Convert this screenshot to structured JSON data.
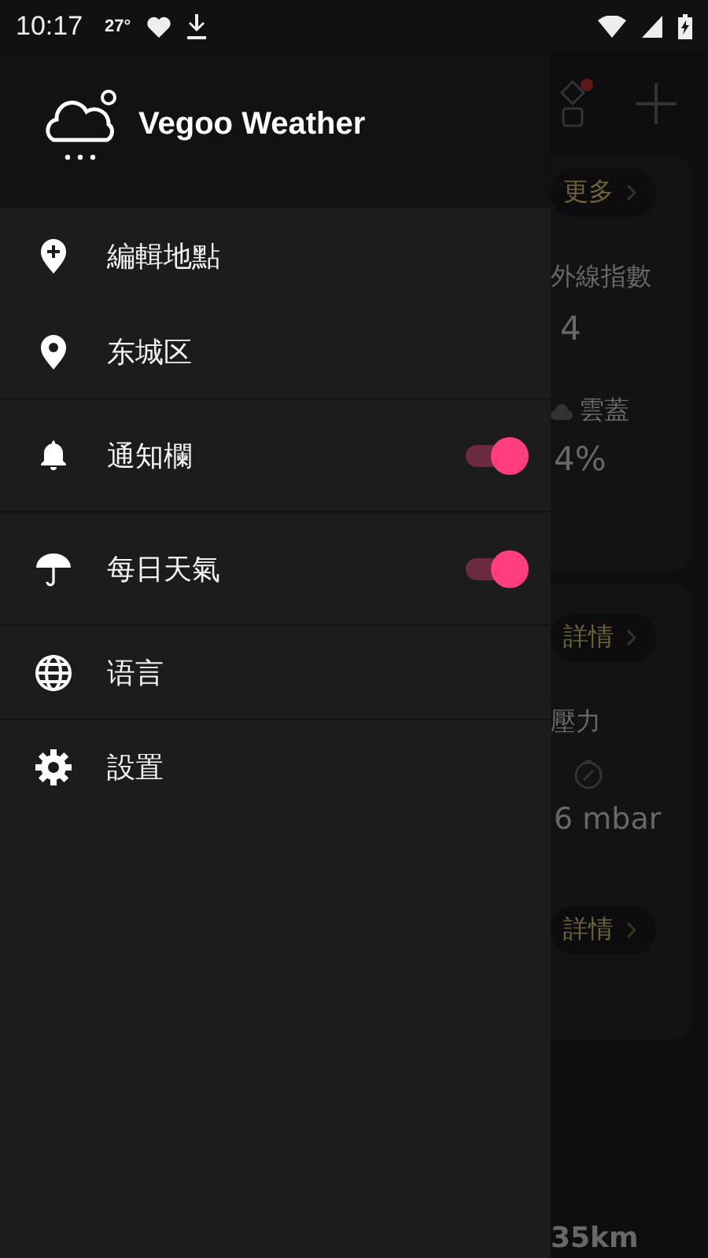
{
  "status_bar": {
    "time": "10:17",
    "temperature": "27°"
  },
  "drawer": {
    "app_name": "Vegoo Weather",
    "menu": [
      {
        "label": "編輯地點",
        "kind": "plain"
      },
      {
        "label": "东城区",
        "kind": "plain"
      },
      {
        "label": "通知欄",
        "kind": "toggle",
        "on": true
      },
      {
        "label": "每日天氣",
        "kind": "toggle",
        "on": true
      },
      {
        "label": "语言",
        "kind": "plain"
      },
      {
        "label": "設置",
        "kind": "plain"
      }
    ]
  },
  "background_screen": {
    "more_button": "更多",
    "uv_label": "外線指數",
    "uv_value": "4",
    "cloud_label": "雲蓋",
    "cloud_value": "4%",
    "details_buttons": [
      "詳情",
      "詳情"
    ],
    "pressure_label": "壓力",
    "pressure_value": "6 mbar",
    "visibility_value": "35km"
  }
}
